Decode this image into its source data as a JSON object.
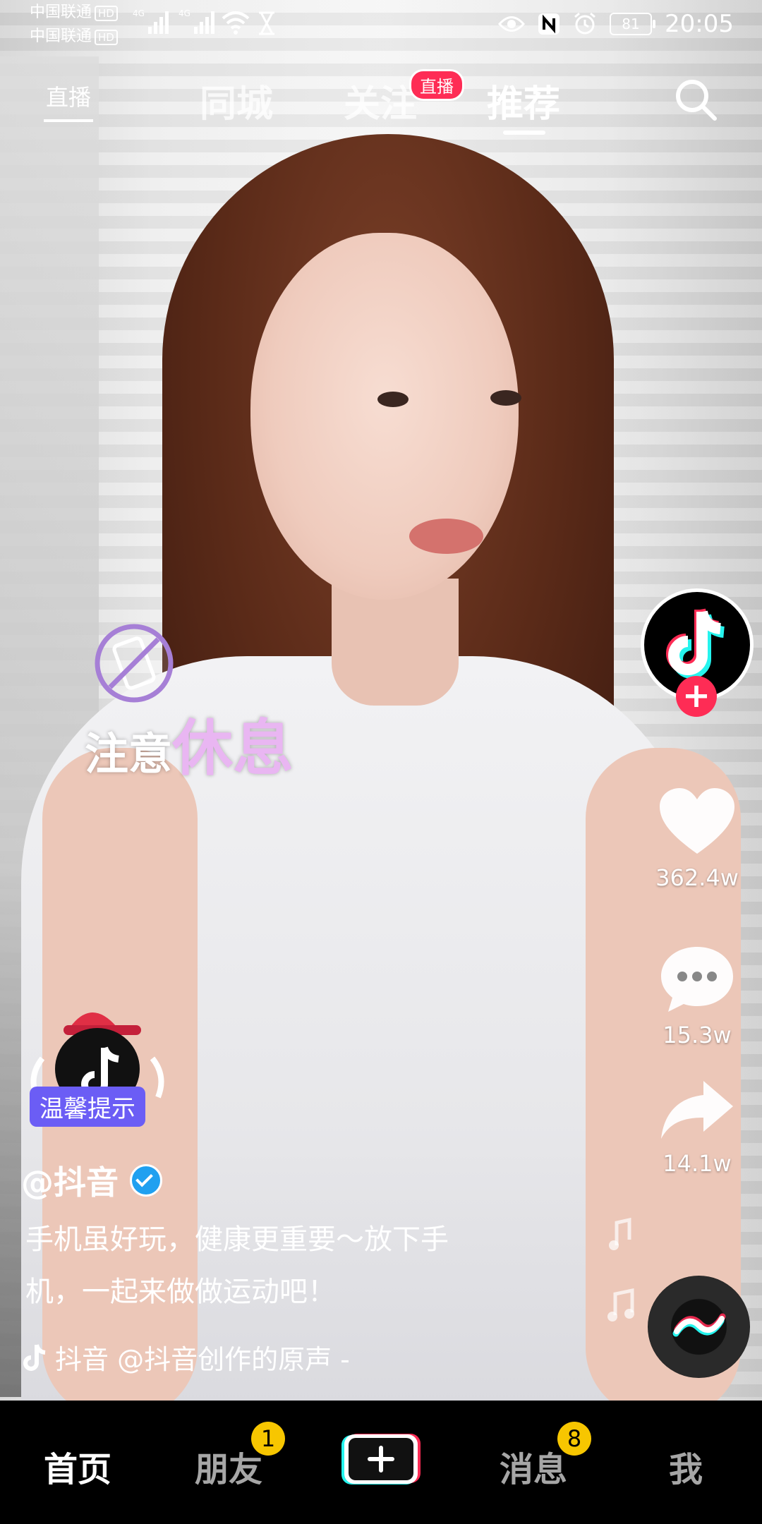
{
  "status_bar": {
    "carrier1": "中国联通",
    "carrier2": "中国联通",
    "hd": "HD",
    "network": "4G",
    "battery": "81",
    "time": "20:05"
  },
  "top_nav": {
    "live_label": "直播",
    "tabs": [
      {
        "label": "同城"
      },
      {
        "label": "关注"
      },
      {
        "label": "推荐"
      }
    ],
    "live_badge": "直播",
    "active_tab": "推荐"
  },
  "overlay": {
    "rest_text_1": "注意",
    "rest_text_2": "休息"
  },
  "actions": {
    "likes": "362.4w",
    "comments": "15.3w",
    "shares": "14.1w"
  },
  "tip": {
    "badge": "温馨提示"
  },
  "video": {
    "author": "@抖音",
    "description_line1": "手机虽好玩，健康更重要～放下手",
    "description_line2": "机，一起来做做运动吧！",
    "music_text": "抖音    @抖音创作的原声 -"
  },
  "bottom_nav": {
    "home": "首页",
    "friends": "朋友",
    "friends_badge": "1",
    "messages": "消息",
    "messages_badge": "8",
    "me": "我"
  },
  "colors": {
    "accent_pink": "#fe2c55",
    "badge_yellow": "#f7c600",
    "tip_purple": "#6b5df5",
    "verified_blue": "#20a0f0"
  }
}
